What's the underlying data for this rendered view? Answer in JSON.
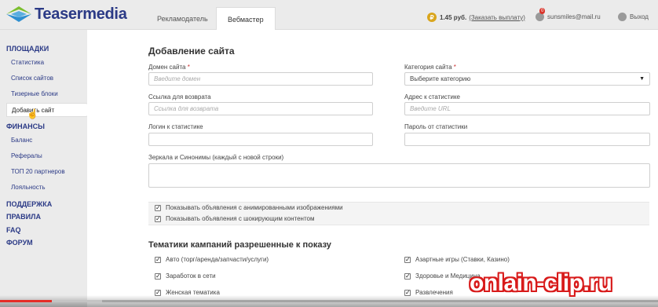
{
  "brand": {
    "name": "Teasermedia",
    "accent": "#2b3a86"
  },
  "header": {
    "tabs": [
      {
        "label": "Рекламодатель",
        "active": false
      },
      {
        "label": "Вебмастер",
        "active": true
      }
    ],
    "balance": {
      "icon": "coin-icon",
      "amount": "1.45 руб.",
      "payout_link": "(Заказать выплату)"
    },
    "user": {
      "badge": "0",
      "email": "sunsmiles@mail.ru"
    },
    "logout": "Выход"
  },
  "sidebar": {
    "sections": [
      {
        "title": "ПЛОЩАДКИ",
        "items": [
          "Статистика",
          "Список сайтов",
          "Тизерные блоки",
          "Добавить сайт"
        ]
      },
      {
        "title": "ФИНАНСЫ",
        "items": [
          "Баланс",
          "Рефералы",
          "ТОП 20 партнеров",
          "Лояльность"
        ]
      },
      {
        "title": "ПОДДЕРЖКА",
        "items": []
      },
      {
        "title": "ПРАВИЛА",
        "items": []
      },
      {
        "title": "FAQ",
        "items": []
      },
      {
        "title": "ФОРУМ",
        "items": []
      }
    ],
    "active_item": "Добавить сайт"
  },
  "form": {
    "title": "Добавление сайта",
    "domain": {
      "label": "Домен сайта",
      "required": "*",
      "placeholder": "Введите домен"
    },
    "category": {
      "label": "Категория сайта",
      "required": "*",
      "value": "Выберите категорию"
    },
    "return_link": {
      "label": "Ссылка для возврата",
      "placeholder": "Ссылка для возврата"
    },
    "stats_url": {
      "label": "Адрес к статистике",
      "placeholder": "Введите URL"
    },
    "stats_login": {
      "label": "Логин к статистике"
    },
    "stats_password": {
      "label": "Пароль от статистики"
    },
    "mirrors": {
      "label": "Зеркала и Синонимы (каждый с новой строки)"
    },
    "options": [
      {
        "label": "Показывать объявления с анимированными изображениями",
        "checked": true
      },
      {
        "label": "Показывать объявления с шокирующим контентом",
        "checked": true
      }
    ],
    "themes_title": "Тематики кампаний разрешенные к показу",
    "themes_left": [
      {
        "label": "Авто (торг/аренда/запчасти/услуги)",
        "checked": true
      },
      {
        "label": "Заработок в сети",
        "checked": true
      },
      {
        "label": "Женская тематика",
        "checked": true
      }
    ],
    "themes_right": [
      {
        "label": "Азартные игры (Ставки, Казино)",
        "checked": true
      },
      {
        "label": "Здоровье и Медицина",
        "checked": true
      },
      {
        "label": "Развлечения",
        "checked": true
      }
    ]
  },
  "overlay": {
    "watermark": "onlain-clip.ru",
    "progress": 0.079,
    "buffered": 0.155
  }
}
